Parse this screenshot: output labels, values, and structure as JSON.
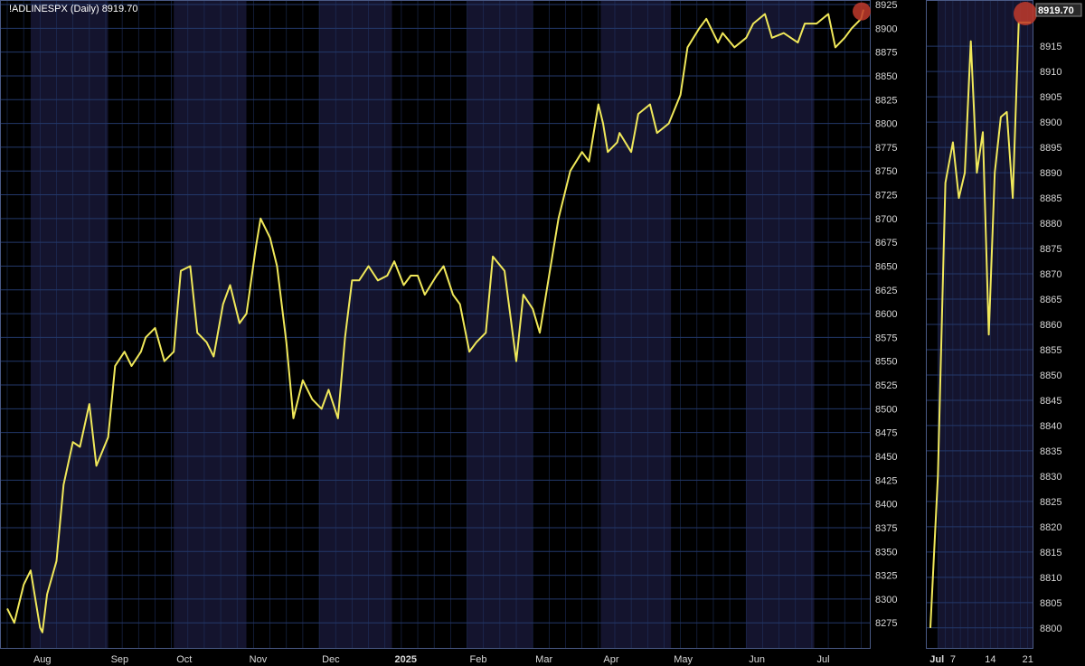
{
  "colors": {
    "background": "#000000",
    "band_dark": "#000000",
    "band_light": "#14142e",
    "grid": "#23386a",
    "line": "#f0e85a",
    "highlight": "#c0392b",
    "text": "#d8d8d8"
  },
  "chart_data": [
    {
      "type": "line",
      "title": "!ADLINESPX (Daily) 8919.70",
      "last_value": "8919.70",
      "ylim": [
        8260,
        8925
      ],
      "yticks": [
        "8925",
        "8900",
        "8875",
        "8850",
        "8825",
        "8800",
        "8775",
        "8750",
        "8725",
        "8700",
        "8675",
        "8650",
        "8625",
        "8600",
        "8575",
        "8550",
        "8525",
        "8500",
        "8475",
        "8450",
        "8425",
        "8400",
        "8375",
        "8350",
        "8325",
        "8300",
        "8275"
      ],
      "xticks": [
        {
          "label": "Aug",
          "x": "2024-08-01",
          "bold": false
        },
        {
          "label": "Sep",
          "x": "2024-09-03",
          "bold": false
        },
        {
          "label": "Oct",
          "x": "2024-10-01",
          "bold": false
        },
        {
          "label": "Nov",
          "x": "2024-11-01",
          "bold": false
        },
        {
          "label": "Dec",
          "x": "2024-12-02",
          "bold": false
        },
        {
          "label": "2025",
          "x": "2025-01-02",
          "bold": true
        },
        {
          "label": "Feb",
          "x": "2025-02-03",
          "bold": false
        },
        {
          "label": "Mar",
          "x": "2025-03-03",
          "bold": false
        },
        {
          "label": "Apr",
          "x": "2025-04-01",
          "bold": false
        },
        {
          "label": "May",
          "x": "2025-05-01",
          "bold": false
        },
        {
          "label": "Jun",
          "x": "2025-06-02",
          "bold": false
        },
        {
          "label": "Jul",
          "x": "2025-07-01",
          "bold": false
        }
      ],
      "series": [
        {
          "x": [
            "2024-07-22",
            "2024-07-25",
            "2024-07-29",
            "2024-08-01",
            "2024-08-05",
            "2024-08-06",
            "2024-08-08",
            "2024-08-12",
            "2024-08-15",
            "2024-08-19",
            "2024-08-22",
            "2024-08-26",
            "2024-08-29",
            "2024-09-03",
            "2024-09-06",
            "2024-09-10",
            "2024-09-13",
            "2024-09-17",
            "2024-09-19",
            "2024-09-23",
            "2024-09-27",
            "2024-10-01",
            "2024-10-04",
            "2024-10-08",
            "2024-10-11",
            "2024-10-15",
            "2024-10-18",
            "2024-10-22",
            "2024-10-25",
            "2024-10-29",
            "2024-11-01",
            "2024-11-05",
            "2024-11-07",
            "2024-11-11",
            "2024-11-14",
            "2024-11-18",
            "2024-11-21",
            "2024-11-25",
            "2024-11-29",
            "2024-12-03",
            "2024-12-06",
            "2024-12-10",
            "2024-12-13",
            "2024-12-16",
            "2024-12-19",
            "2024-12-23",
            "2024-12-27",
            "2024-12-31",
            "2025-01-03",
            "2025-01-07",
            "2025-01-10",
            "2025-01-13",
            "2025-01-16",
            "2025-01-21",
            "2025-01-24",
            "2025-01-28",
            "2025-01-31",
            "2025-02-04",
            "2025-02-07",
            "2025-02-11",
            "2025-02-14",
            "2025-02-19",
            "2025-02-24",
            "2025-02-27",
            "2025-03-03",
            "2025-03-06",
            "2025-03-10",
            "2025-03-12",
            "2025-03-14",
            "2025-03-19",
            "2025-03-24",
            "2025-03-27",
            "2025-03-31",
            "2025-04-02",
            "2025-04-04",
            "2025-04-08",
            "2025-04-09",
            "2025-04-14",
            "2025-04-17",
            "2025-04-22",
            "2025-04-25",
            "2025-04-30",
            "2025-05-05",
            "2025-05-08",
            "2025-05-13",
            "2025-05-16",
            "2025-05-21",
            "2025-05-23",
            "2025-05-28",
            "2025-06-02",
            "2025-06-05",
            "2025-06-10",
            "2025-06-13",
            "2025-06-18",
            "2025-06-24",
            "2025-06-27",
            "2025-07-02",
            "2025-07-07",
            "2025-07-10",
            "2025-07-14",
            "2025-07-17",
            "2025-07-21",
            "2025-07-22"
          ],
          "values": [
            8290,
            8275,
            8315,
            8330,
            8270,
            8265,
            8305,
            8340,
            8420,
            8465,
            8460,
            8505,
            8440,
            8470,
            8545,
            8560,
            8545,
            8560,
            8575,
            8585,
            8550,
            8560,
            8645,
            8650,
            8580,
            8570,
            8555,
            8610,
            8630,
            8590,
            8600,
            8670,
            8700,
            8680,
            8650,
            8570,
            8490,
            8530,
            8510,
            8500,
            8520,
            8490,
            8575,
            8635,
            8635,
            8650,
            8635,
            8640,
            8655,
            8630,
            8640,
            8640,
            8620,
            8640,
            8650,
            8620,
            8610,
            8560,
            8570,
            8580,
            8660,
            8645,
            8550,
            8620,
            8605,
            8580,
            8640,
            8670,
            8700,
            8750,
            8770,
            8760,
            8820,
            8800,
            8770,
            8780,
            8790,
            8770,
            8810,
            8820,
            8790,
            8800,
            8830,
            8880,
            8900,
            8910,
            8885,
            8895,
            8880,
            8890,
            8905,
            8915,
            8890,
            8895,
            8885,
            8905,
            8905,
            8915,
            8880,
            8890,
            8900,
            8910,
            8919.7
          ]
        }
      ]
    },
    {
      "type": "line",
      "last_value": "8919.70",
      "ylim": [
        8798,
        8922
      ],
      "yticks": [
        "8915",
        "8910",
        "8905",
        "8900",
        "8895",
        "8890",
        "8885",
        "8880",
        "8875",
        "8870",
        "8865",
        "8860",
        "8855",
        "8850",
        "8845",
        "8840",
        "8835",
        "8830",
        "8825",
        "8820",
        "8815",
        "8810",
        "8805",
        "8800"
      ],
      "xticks": [
        {
          "label": "Jul",
          "x": 1.0,
          "bold": true
        },
        {
          "label": "7",
          "x": 3.0,
          "bold": false
        },
        {
          "label": "14",
          "x": 8.0,
          "bold": false
        },
        {
          "label": "21",
          "x": 13.0,
          "bold": false
        }
      ],
      "series": [
        {
          "x": [
            0,
            1,
            2,
            3,
            3.8,
            4.6,
            5.4,
            6.2,
            7.0,
            7.8,
            8.6,
            9.4,
            10.2,
            11.0,
            11.8,
            12.6,
            13.4
          ],
          "values": [
            8800,
            8830,
            8888,
            8896,
            8885,
            8890,
            8916,
            8890,
            8898,
            8858,
            8890,
            8901,
            8902,
            8885,
            8919.7,
            8919.7,
            8919.7
          ]
        }
      ]
    }
  ]
}
